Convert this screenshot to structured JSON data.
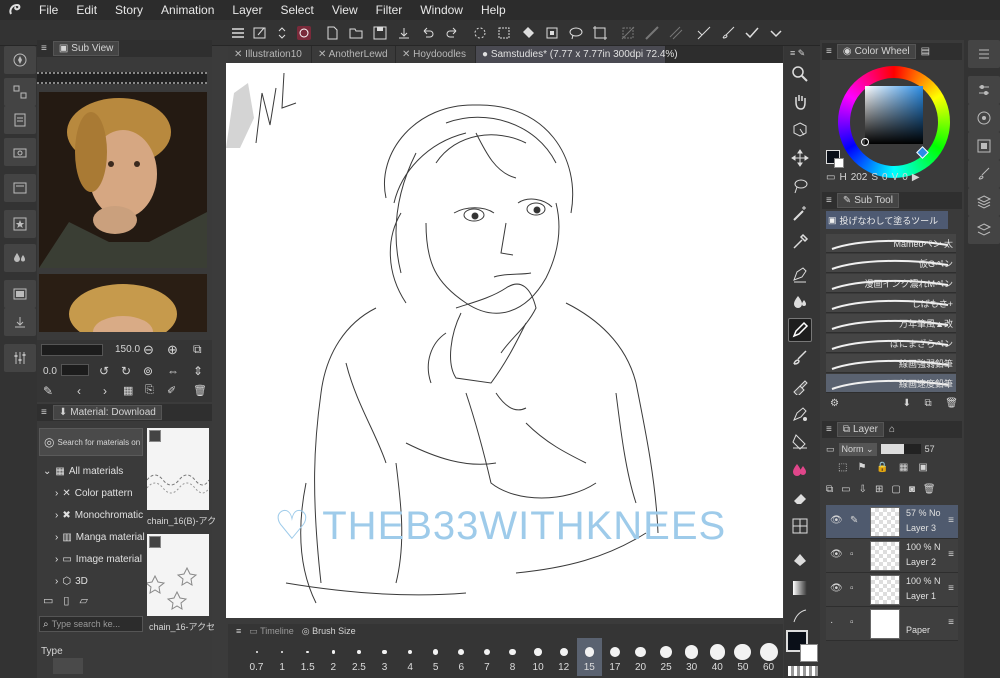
{
  "menu": {
    "items": [
      "File",
      "Edit",
      "Story",
      "Animation",
      "Layer",
      "Select",
      "View",
      "Filter",
      "Window",
      "Help"
    ]
  },
  "sub_view": {
    "title": "Sub View",
    "zoom": "150.0",
    "angle": "0.0"
  },
  "tabs": [
    {
      "label": "Illustration10",
      "active": false
    },
    {
      "label": "AnotherLewd",
      "active": false
    },
    {
      "label": "Hoydoodles",
      "active": false
    },
    {
      "label": "Samstudies* (7.77 x 7.77in 300dpi 72.4%)",
      "active": true
    }
  ],
  "canvas": {
    "watermark": "THEB33WITHKNEES"
  },
  "material": {
    "title": "Material: Download",
    "search_label": "Search for materials on A",
    "tree": [
      {
        "label": "All materials"
      },
      {
        "label": "Color pattern"
      },
      {
        "label": "Monochromatic"
      },
      {
        "label": "Manga material"
      },
      {
        "label": "Image material"
      },
      {
        "label": "3D"
      }
    ],
    "items": [
      {
        "label": "chain_16(B)-アク"
      },
      {
        "label": "chain_16-アクセ"
      }
    ],
    "search_placeholder": "Type search ke...",
    "type_label": "Type"
  },
  "timeline_tab": "Timeline",
  "brush_size": {
    "title": "Brush Size",
    "sizes": [
      "0.7",
      "1",
      "1.5",
      "2",
      "2.5",
      "3",
      "4",
      "5",
      "6",
      "7",
      "8",
      "10",
      "12",
      "15",
      "17",
      "20",
      "25",
      "30",
      "40",
      "50",
      "60"
    ],
    "selected": "15"
  },
  "color_wheel": {
    "title": "Color Wheel",
    "h": "202",
    "s": "0",
    "v": "0",
    "main_color": "#0a0f18"
  },
  "sub_tool": {
    "title": "Sub Tool",
    "header": "投げなわして塗るツール",
    "items": [
      {
        "label": "Mameoペン 太"
      },
      {
        "label": "仮Gペン"
      },
      {
        "label": "漫画インク濃れMペン"
      },
      {
        "label": "しばもさ+"
      },
      {
        "label": "万年筆風▲改"
      },
      {
        "label": "ばにまざらペン"
      },
      {
        "label": "線画強弱鉛筆"
      },
      {
        "label": "線画速度鉛筆"
      }
    ],
    "selected": "線画速度鉛筆"
  },
  "layer": {
    "title": "Layer",
    "blend": "Norm",
    "opacity": "57",
    "rows": [
      {
        "opacity": "57 % No",
        "name": "Layer 3",
        "selected": true
      },
      {
        "opacity": "100 % N",
        "name": "Layer 2",
        "selected": false
      },
      {
        "opacity": "100 % N",
        "name": "Layer 1",
        "selected": false
      },
      {
        "opacity": "",
        "name": "Paper",
        "selected": false
      }
    ]
  }
}
